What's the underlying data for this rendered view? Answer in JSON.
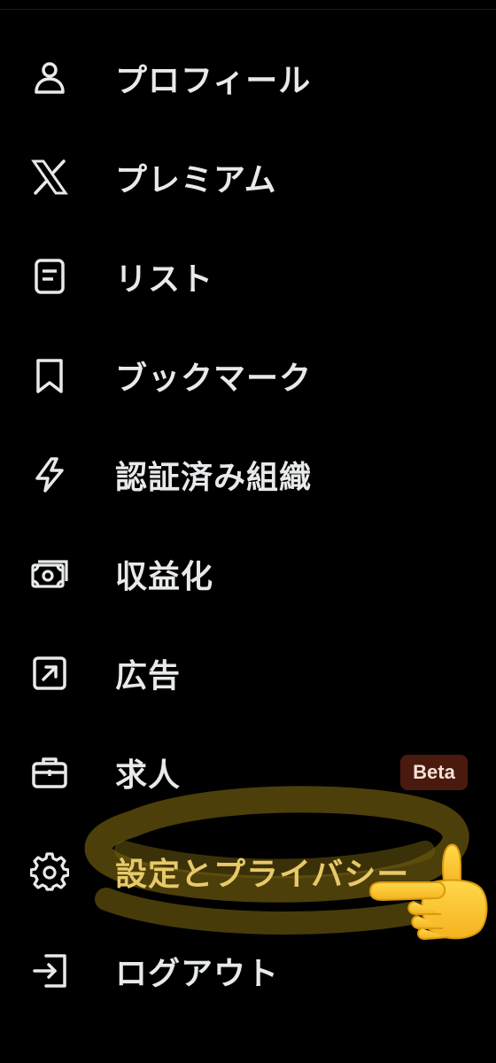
{
  "menu": {
    "items": [
      {
        "label": "プロフィール",
        "icon": "person-icon"
      },
      {
        "label": "プレミアム",
        "icon": "x-logo-icon"
      },
      {
        "label": "リスト",
        "icon": "list-document-icon"
      },
      {
        "label": "ブックマーク",
        "icon": "bookmark-icon"
      },
      {
        "label": "認証済み組織",
        "icon": "lightning-icon"
      },
      {
        "label": "収益化",
        "icon": "money-icon"
      },
      {
        "label": "広告",
        "icon": "external-link-icon"
      },
      {
        "label": "求人",
        "icon": "briefcase-icon",
        "badge": "Beta"
      },
      {
        "label": "設定とプライバシー",
        "icon": "gear-icon",
        "highlighted": true
      },
      {
        "label": "ログアウト",
        "icon": "logout-icon"
      }
    ]
  },
  "annotation": {
    "highlight_color": "#6b5a10",
    "highlighted_text_color": "#e8c96a",
    "pointer": "pointing-hand-emoji"
  },
  "colors": {
    "background": "#000000",
    "text": "#e7e9ea",
    "badge_background": "#4a1a0e",
    "badge_text": "#f4e0d6"
  }
}
